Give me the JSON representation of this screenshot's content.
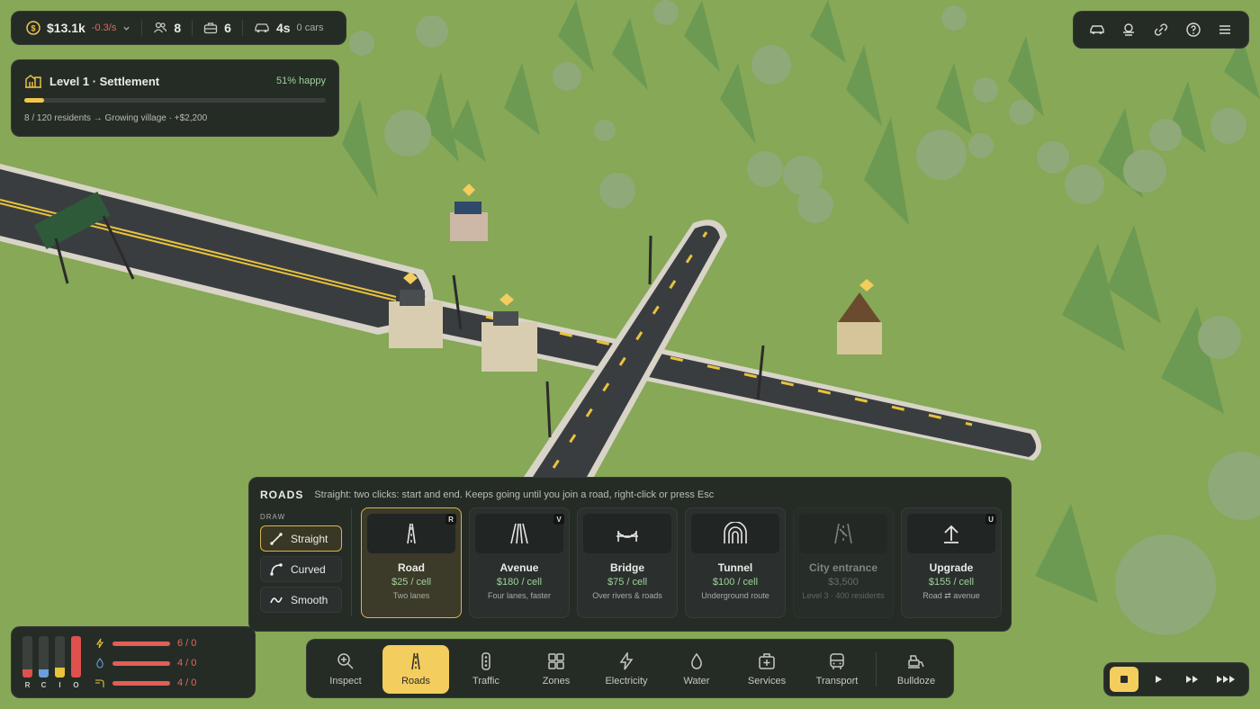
{
  "stats": {
    "money": "$13.1k",
    "rate": "-0.3/s",
    "residents": "8",
    "jobs": "6",
    "commute": "4s",
    "cars": "0 cars"
  },
  "level": {
    "title": "Level 1 · Settlement",
    "happiness": "51% happy",
    "progress_fraction": 0.067,
    "subtitle": "8 / 120 residents → Growing village · +$2,200"
  },
  "top_toolbar": [
    "car-icon",
    "weather-icon",
    "link-icon",
    "help-icon",
    "menu-icon"
  ],
  "roads_panel": {
    "title": "ROADS",
    "hint": "Straight: two clicks: start and end. Keeps going until you join a road, right-click or press Esc",
    "draw_label": "DRAW",
    "modes": [
      {
        "label": "Straight",
        "active": true
      },
      {
        "label": "Curved",
        "active": false
      },
      {
        "label": "Smooth",
        "active": false
      }
    ],
    "cards": [
      {
        "name": "Road",
        "price": "$25 / cell",
        "desc": "Two lanes",
        "key": "R",
        "active": true
      },
      {
        "name": "Avenue",
        "price": "$180 / cell",
        "desc": "Four lanes, faster",
        "key": "V"
      },
      {
        "name": "Bridge",
        "price": "$75 / cell",
        "desc": "Over rivers & roads",
        "key": ""
      },
      {
        "name": "Tunnel",
        "price": "$100 / cell",
        "desc": "Underground route",
        "key": ""
      },
      {
        "name": "City entrance",
        "price": "$3,500",
        "desc": "Level 3 · 400 residents",
        "key": "",
        "disabled": true
      },
      {
        "name": "Upgrade",
        "price": "$155 / cell",
        "desc": "Road ⇄ avenue",
        "key": "U"
      }
    ]
  },
  "meters": {
    "bars": [
      {
        "label": "R",
        "color": "#e0504d",
        "level": 0.2
      },
      {
        "label": "C",
        "color": "#6a9ee0",
        "level": 0.2
      },
      {
        "label": "I",
        "color": "#e8c33b",
        "level": 0.25
      },
      {
        "label": "O",
        "color": "#e0504d",
        "level": 1.0
      }
    ],
    "rows": [
      {
        "icon": "bolt-icon",
        "value": "6 / 0"
      },
      {
        "icon": "drop-icon",
        "value": "4 / 0"
      },
      {
        "icon": "pipe-icon",
        "value": "4 / 0"
      }
    ]
  },
  "tools": [
    {
      "label": "Inspect"
    },
    {
      "label": "Roads",
      "active": true
    },
    {
      "label": "Traffic"
    },
    {
      "label": "Zones"
    },
    {
      "label": "Electricity"
    },
    {
      "label": "Water"
    },
    {
      "label": "Services"
    },
    {
      "label": "Transport"
    },
    {
      "label": "Bulldoze"
    }
  ],
  "speed": [
    "pause",
    "play",
    "fast",
    "fastest"
  ],
  "colors": {
    "accent": "#f3cd5d",
    "grass": "#86a857",
    "road": "#3a3d40",
    "tree": "#6d9a52"
  }
}
